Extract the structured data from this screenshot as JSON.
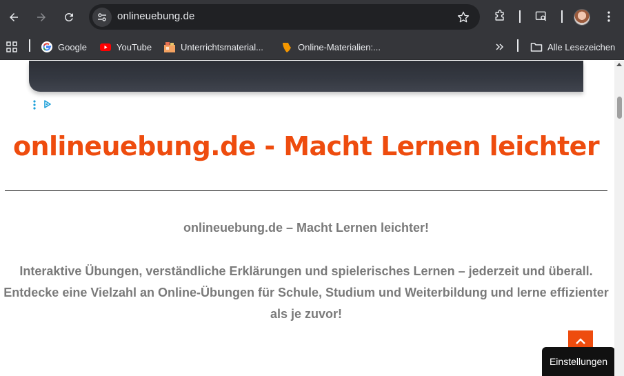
{
  "browser": {
    "url": "onlineuebung.de",
    "bookmarks": [
      {
        "label": "Google",
        "icon": "google-icon"
      },
      {
        "label": "YouTube",
        "icon": "youtube-icon"
      },
      {
        "label": "Unterrichtsmaterial...",
        "icon": "folder-image-icon"
      },
      {
        "label": "Online-Materialien:...",
        "icon": "typo3-icon"
      }
    ],
    "all_bookmarks_label": "Alle Lesezeichen"
  },
  "page": {
    "headline": "onlineuebung.de - Macht Lernen leichter",
    "subtitle": "onlineuebung.de – Macht Lernen leichter!",
    "paragraph": "Interaktive Übungen, verständliche Erklärungen und spielerisches Lernen – jederzeit und überall. Entdecke eine Vielzahl an Online-Übungen für Schule, Studium und Weiterbildung und lerne effizienter als je zuvor!",
    "settings_label": "Einstellungen"
  },
  "colors": {
    "accent": "#ee4c0e",
    "text_gray": "#7a7a7a",
    "chrome_bg": "#35363a"
  }
}
